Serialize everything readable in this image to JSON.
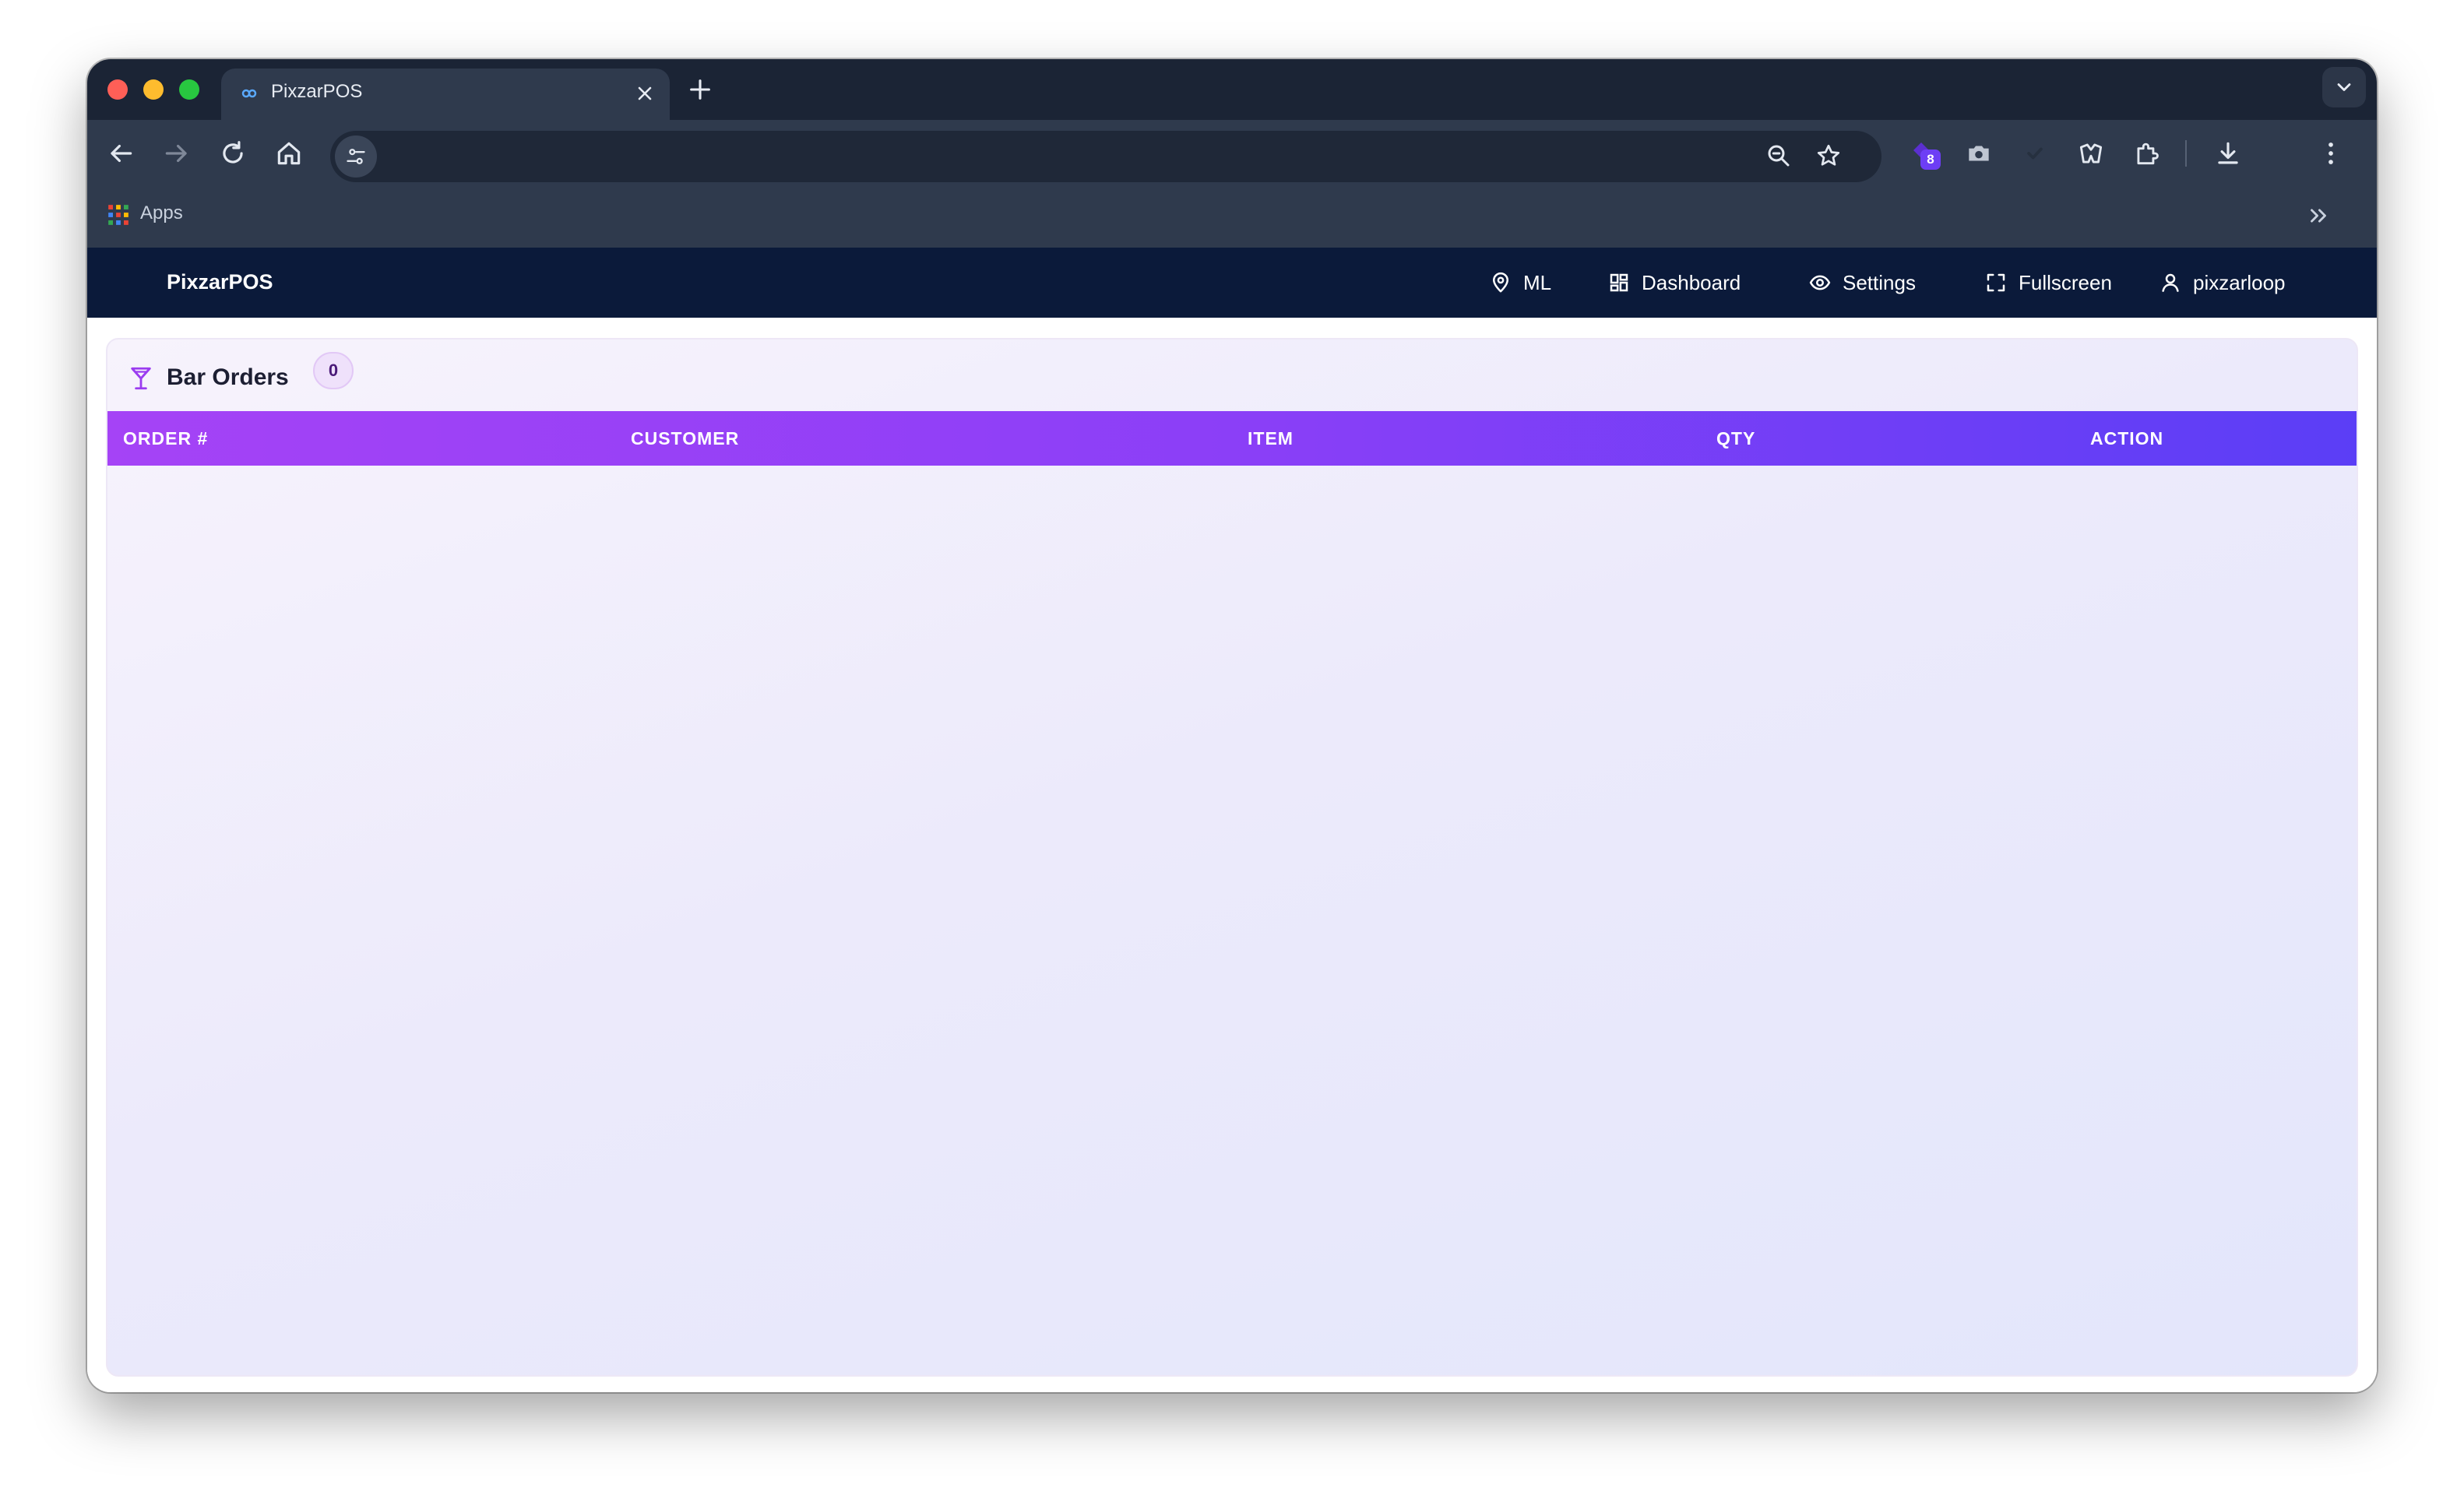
{
  "browser": {
    "tab_title": "PixzarPOS",
    "bookmarks_apps_label": "Apps",
    "extension_badge": "8"
  },
  "app": {
    "brand": "PixzarPOS",
    "nav": {
      "location_label": "ML",
      "dashboard_label": "Dashboard",
      "settings_label": "Settings",
      "fullscreen_label": "Fullscreen",
      "user_label": "pixzarloop"
    }
  },
  "panel": {
    "title": "Bar Orders",
    "count": "0",
    "columns": [
      "ORDER #",
      "CUSTOMER",
      "ITEM",
      "QTY",
      "ACTION"
    ],
    "rows": []
  },
  "colors": {
    "navbar_bg": "#0b1a3a",
    "table_header_start": "#a543f6",
    "table_header_end": "#5b3ef6",
    "icon_accent": "#9b3cf0"
  }
}
